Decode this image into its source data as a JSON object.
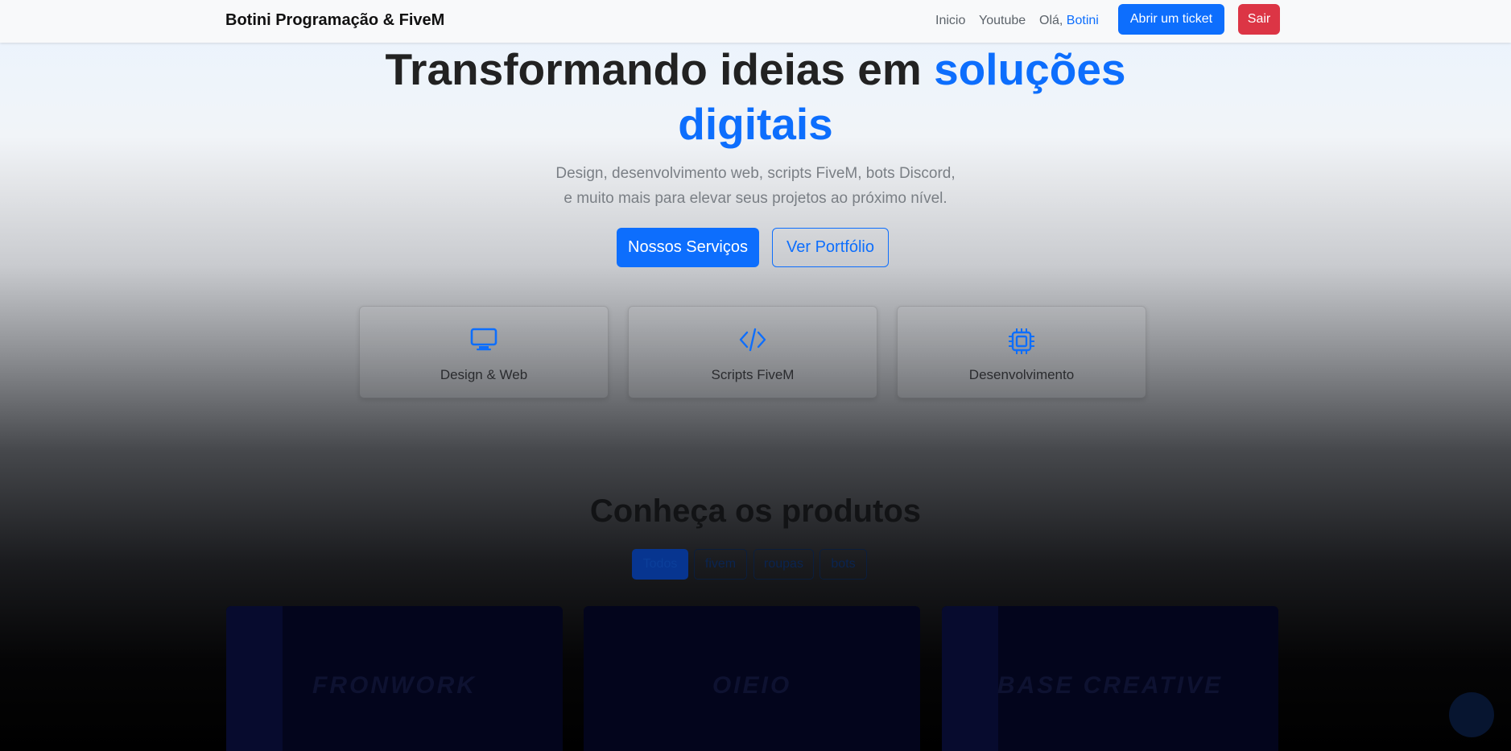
{
  "navbar": {
    "brand": "Botini Programação & FiveM",
    "home_link": "Inicio",
    "youtube_link": "Youtube",
    "greeting_prefix": "Olá,",
    "user_name": "Botini",
    "ticket_button": "Abrir um ticket",
    "exit_button": "Sair"
  },
  "hero": {
    "title_part1": "Transformando ideias em",
    "title_accent_1": "soluções",
    "title_accent_2": "digitais",
    "subtitle_line1": "Design, desenvolvimento web, scripts FiveM, bots Discord,",
    "subtitle_line2": "e muito mais para elevar seus projetos ao próximo nível.",
    "primary_button": "Nossos Serviços",
    "secondary_button": "Ver Portfólio",
    "accent_color": "#0d6efd"
  },
  "services": [
    {
      "label": "Design & Web",
      "icon": "monitor-icon"
    },
    {
      "label": "Scripts FiveM",
      "icon": "code-icon"
    },
    {
      "label": "Desenvolvimento",
      "icon": "cpu-icon"
    }
  ],
  "products": {
    "title": "Conheça os produtos",
    "filters": [
      "Todos",
      "fivem",
      "roupas",
      "bots"
    ],
    "active_filter": "Todos",
    "cards": [
      {
        "logo_text": "FRONWORK"
      },
      {
        "logo_text": "OIEIO"
      },
      {
        "logo_text": "BASE CREATIVE"
      }
    ]
  }
}
